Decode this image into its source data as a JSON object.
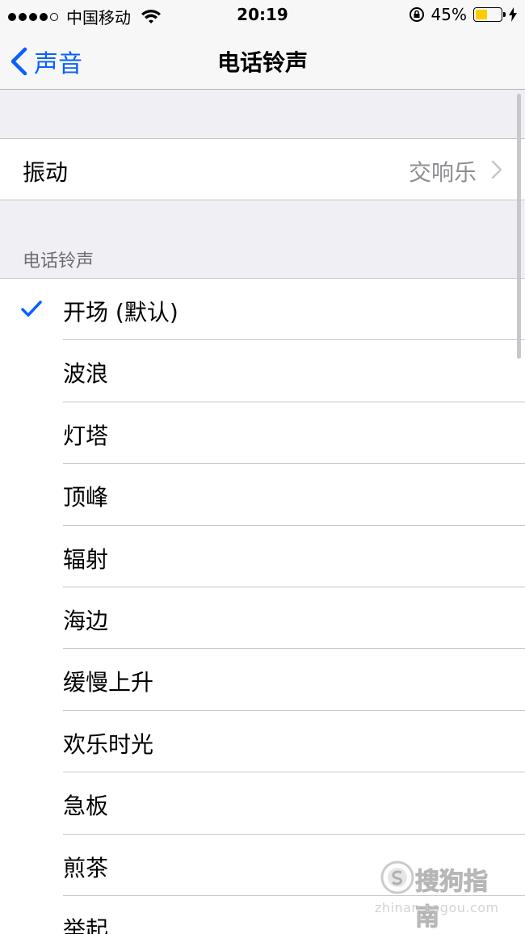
{
  "status_bar": {
    "carrier": "中国移动",
    "time": "20:19",
    "battery_percent": "45%",
    "battery_level": 0.45,
    "battery_color": "#ffcc00"
  },
  "nav": {
    "back_label": "声音",
    "title": "电话铃声",
    "accent_color": "#0a60ff"
  },
  "vibration": {
    "label": "振动",
    "value": "交响乐"
  },
  "ringtones": {
    "section_header": "电话铃声",
    "items": [
      {
        "label": "开场 (默认)",
        "selected": true
      },
      {
        "label": "波浪",
        "selected": false
      },
      {
        "label": "灯塔",
        "selected": false
      },
      {
        "label": "顶峰",
        "selected": false
      },
      {
        "label": "辐射",
        "selected": false
      },
      {
        "label": "海边",
        "selected": false
      },
      {
        "label": "缓慢上升",
        "selected": false
      },
      {
        "label": "欢乐时光",
        "selected": false
      },
      {
        "label": "急板",
        "selected": false
      },
      {
        "label": "煎茶",
        "selected": false
      },
      {
        "label": "举起",
        "selected": false
      }
    ]
  },
  "watermark": {
    "brand": "搜狗指南",
    "url": "zhinan.sogou.com"
  }
}
